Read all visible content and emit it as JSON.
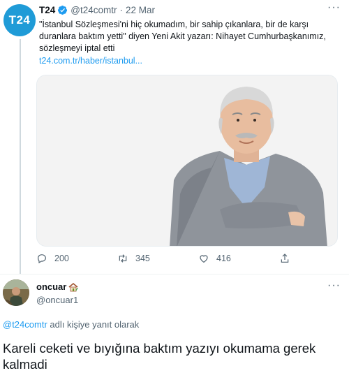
{
  "quoted_tweet": {
    "avatar_text": "T24",
    "name": "T24",
    "handle": "@t24comtr",
    "separator": "·",
    "date": "22 Mar",
    "text": "\"İstanbul Sözleşmesi'ni hiç okumadım, bir sahip çıkanlara, bir de karşı duranlara baktım yetti\" diyen Yeni Akit yazarı: Nihayet Cumhurbaşkanımız, sözleşmeyi iptal etti",
    "link": "t24.com.tr/haber/istanbul...",
    "stats": {
      "replies": "200",
      "retweets": "345",
      "likes": "416"
    }
  },
  "reply_tweet": {
    "name": "oncuar",
    "handle": "@oncuar1",
    "reply_to_mention": "@t24comtr",
    "reply_to_suffix": " adlı kişiye yanıt olarak",
    "text": "Kareli ceketi ve bıyığına baktım yazıyı okumama gerek kalmadi"
  },
  "colors": {
    "accent": "#1d9bf0",
    "t24_brand": "#1f9bd7",
    "muted": "#536471",
    "text": "#0f1419"
  },
  "icons": [
    "verified-badge-icon",
    "more-options-icon",
    "reply-icon",
    "retweet-icon",
    "like-icon",
    "share-icon",
    "house-emoji-icon"
  ]
}
